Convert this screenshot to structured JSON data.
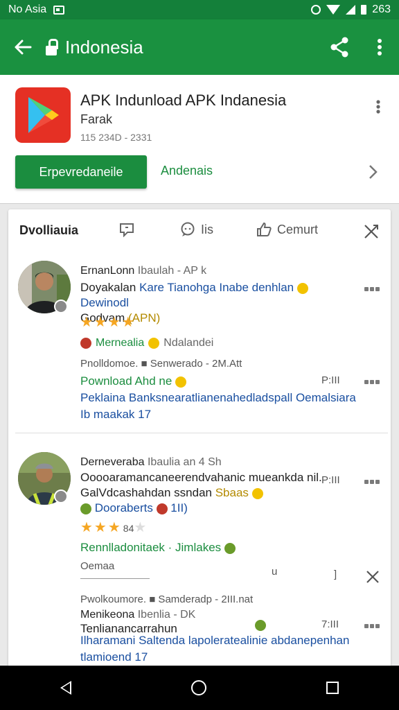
{
  "status_bar": {
    "carrier": "No Asia",
    "time": "263"
  },
  "app_bar": {
    "title": "Indonesia"
  },
  "app": {
    "name": "APK Indunload APK Indanesia",
    "developer": "Farak",
    "meta": "115 234D - 2331",
    "install_label": "Erpevredaneile",
    "secondary_label": "Andenais"
  },
  "reviews": {
    "title": "Dvolliauia",
    "tabs": [
      {
        "label": ""
      },
      {
        "label": "Iis"
      },
      {
        "label": "Cemurt"
      }
    ],
    "items": [
      {
        "name": "ErnanLonn",
        "name_sub": "Ibaulah - AP k",
        "text_a": "Doyakalan ",
        "text_b": "Kare Tianohga Inabe denhlan",
        "text_c": " Dewinodl",
        "text_d": "Godvam ",
        "text_e": "(APN)",
        "stars": "★★★★",
        "tag_a": "Mernealia",
        "tag_b": "Ndalandei",
        "meta": "Pnolldomoe. ■ Senwerado - 2M.Att",
        "green": "Pownload Ahd ne",
        "time": "P:III",
        "blue": "Peklaina Banksnearatlianenahedladspall Oemalsiara Ib maakak 17"
      },
      {
        "name": "Derneveraba",
        "name_sub": "Ibaulia an 4 Sh",
        "text_a": "Ooooaramancaneerendvahanic mueankda nil.",
        "text_b": "GalVdcashahdan ssndan",
        "text_c": " Sbaas",
        "text_d": "Dooraberts",
        "text_e": " 1II)",
        "stars": "★★★",
        "stars_count": "84",
        "green": "Rennlladonitaek · Jimlakes",
        "time": "P:III",
        "extra": "Oemaa",
        "extra_mark": "u",
        "extra_bracket": "]"
      },
      {
        "meta": "Pwolkoumore. ■ Samderadp - 2III.nat",
        "name": "Menikeona",
        "name_sub": "Ibenlia - DK",
        "text": "Tenlianancarrahun",
        "time": "7:III",
        "blue": "Ilharamani Saltenda lapoleratealinie abdanepenhan tlamioend 17"
      }
    ]
  }
}
